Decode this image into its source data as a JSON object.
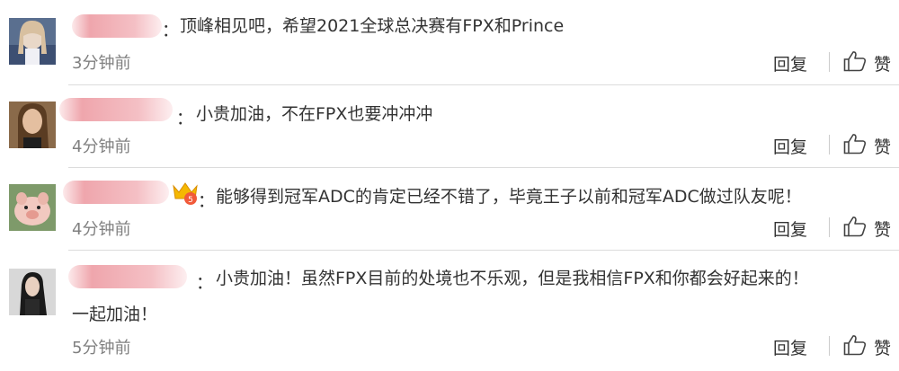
{
  "comments": [
    {
      "text": "顶峰相见吧，希望2021全球总决赛有FPX和Prince",
      "time": "3分钟前",
      "colon": "："
    },
    {
      "text": "小贵加油，不在FPX也要冲冲冲",
      "time": "4分钟前",
      "colon": "："
    },
    {
      "text": "能够得到冠军ADC的肯定已经不错了，毕竟王子以前和冠军ADC做过队友呢！",
      "time": "4分钟前",
      "colon": "："
    },
    {
      "text": "小贵加油！虽然FPX目前的处境也不乐观，但是我相信FPX和你都会好起来的！",
      "text2": "一起加油！",
      "time": "5分钟前",
      "colon": "："
    }
  ],
  "actions": {
    "reply_label": "回复",
    "like_label": "赞"
  },
  "colors": {
    "divider": "#dcdcdc",
    "time": "#808080",
    "text": "#333333",
    "name_blur": "#ec969e"
  },
  "icons": {
    "like": "thumbs-up-icon",
    "badge": "crown-badge-icon"
  }
}
